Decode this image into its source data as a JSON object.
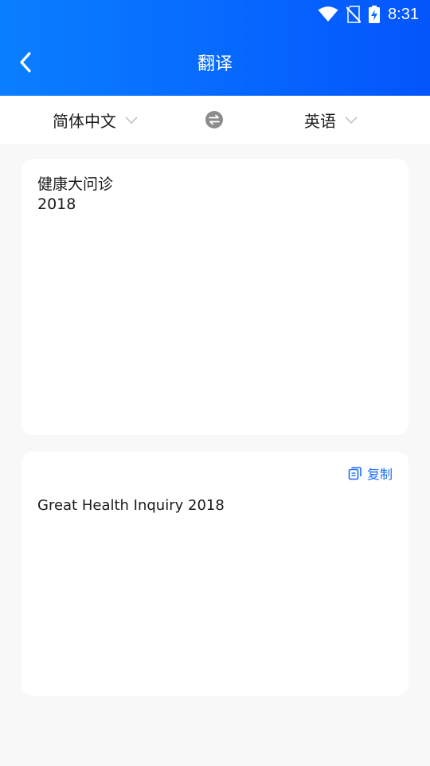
{
  "status_bar": {
    "time": "8:31",
    "icons": [
      "wifi-icon",
      "no-sim-icon",
      "battery-charging-icon"
    ]
  },
  "header": {
    "title": "翻译",
    "back_icon": "chevron-left-icon",
    "background": "#0a74ff"
  },
  "language_bar": {
    "source_language": "简体中文",
    "target_language": "英语",
    "swap_icon": "swap-arrows-icon",
    "dropdown_icon": "chevron-down-icon"
  },
  "source_card": {
    "text": "健康大问诊\n2018"
  },
  "result_card": {
    "copy_label": "复制",
    "copy_icon": "copy-icon",
    "text": "Great Health Inquiry 2018",
    "accent_color": "#1a6ef5"
  }
}
